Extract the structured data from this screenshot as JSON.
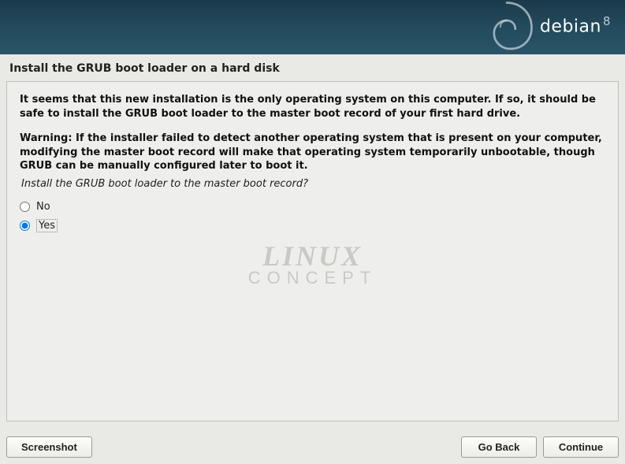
{
  "header": {
    "brand": "debian",
    "version": "8"
  },
  "page": {
    "title": "Install the GRUB boot loader on a hard disk",
    "intro": "It seems that this new installation is the only operating system on this computer. If so, it should be safe to install the GRUB boot loader to the master boot record of your first hard drive.",
    "warning_label": "Warning:",
    "warning_body": " If the installer failed to detect another operating system that is present on your computer, modifying the master boot record will make that operating system temporarily unbootable, though GRUB can be manually configured later to boot it.",
    "question": "Install the GRUB boot loader to the master boot record?",
    "options": {
      "no": "No",
      "yes": "Yes"
    },
    "selected": "yes"
  },
  "watermark": {
    "line1": "LINUX",
    "line2": "CONCEPT"
  },
  "footer": {
    "screenshot": "Screenshot",
    "go_back": "Go Back",
    "continue": "Continue"
  }
}
